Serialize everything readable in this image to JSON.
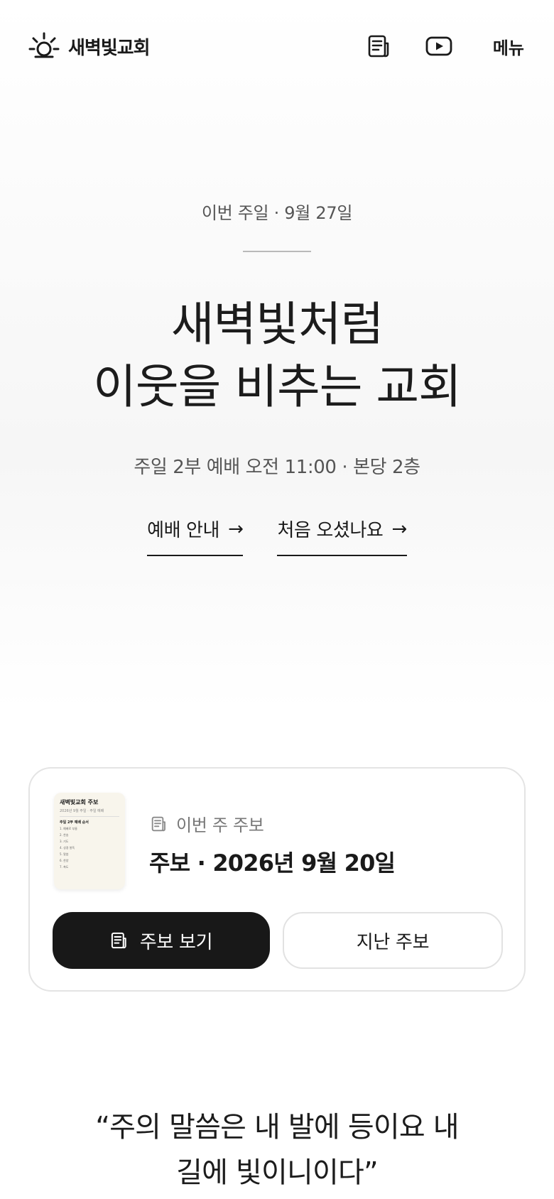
{
  "header": {
    "brand_name": "새벽빛교회",
    "logo_icon": "sunrise-icon",
    "bulletin_icon": "bulletin-icon",
    "youtube_icon": "youtube-icon",
    "menu_label": "메뉴"
  },
  "hero": {
    "eyebrow": "이번 주일 · 9월 27일",
    "title_line1": "새벽빛처럼",
    "title_line2": "이웃을 비추는 교회",
    "service_time": "주일 2부 예배 오전 11:00 · 본당 2층",
    "links": [
      {
        "label": "예배 안내",
        "arrow": "→"
      },
      {
        "label": "처음 오셨나요",
        "arrow": "→"
      }
    ]
  },
  "bulletin_card": {
    "label": "이번 주 주보",
    "title": "주보 · 2026년 9월 20일",
    "thumbnail": {
      "title": "새벽빛교회 주보",
      "subtitle": "2026년 9월 주일 · 주일 예배",
      "heading": "주일 2부 예배 순서",
      "items": [
        "1. 예배로 부름",
        "2. 찬송",
        "3. 기도",
        "4. 성경 봉독",
        "5. 말씀",
        "6. 찬양",
        "7. 축도"
      ]
    },
    "view_button": "주보 보기",
    "past_button": "지난 주보"
  },
  "verse": {
    "line1": "“주의 말씀은 내 발에 등이요 내",
    "line2": "길에 빛이니이다”"
  },
  "colors": {
    "text_primary": "#1a1a1a",
    "text_secondary": "#555555",
    "button_dark": "#181818",
    "card_border": "#e4e4e4"
  }
}
